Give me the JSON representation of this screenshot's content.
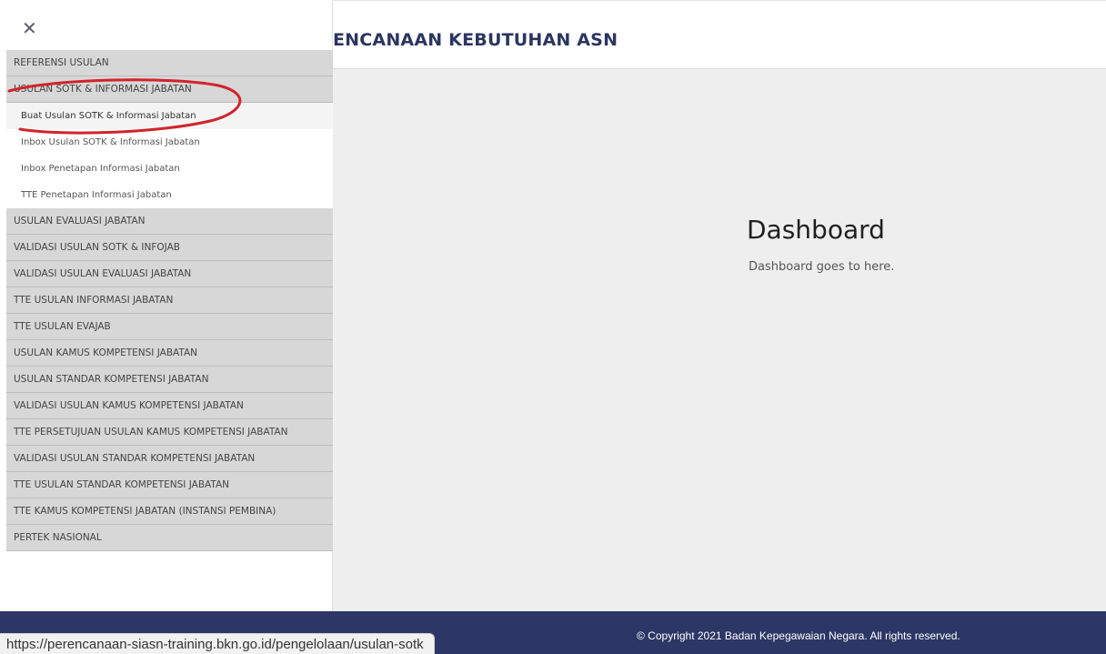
{
  "top_highlight_color": "#fff200",
  "header": {
    "title": "ENCANAAN KEBUTUHAN ASN"
  },
  "dashboard": {
    "title": "Dashboard",
    "subtitle": "Dashboard goes to here."
  },
  "sidebar": {
    "close_icon": "close-icon",
    "close_glyph": "✕",
    "items": [
      {
        "label": "REFERENSI USULAN",
        "type": "main"
      },
      {
        "label": "USULAN SOTK & INFORMASI JABATAN",
        "type": "main",
        "expanded": true
      },
      {
        "label": "Buat Usulan SOTK & Informasi Jabatan",
        "type": "sub",
        "active": true
      },
      {
        "label": "Inbox Usulan SOTK & Informasi Jabatan",
        "type": "sub"
      },
      {
        "label": "Inbox Penetapan Informasi Jabatan",
        "type": "sub"
      },
      {
        "label": "TTE Penetapan Informasi Jabatan",
        "type": "sub"
      },
      {
        "label": "USULAN EVALUASI JABATAN",
        "type": "main"
      },
      {
        "label": "VALIDASI USULAN SOTK & INFOJAB",
        "type": "main"
      },
      {
        "label": "VALIDASI USULAN EVALUASI JABATAN",
        "type": "main"
      },
      {
        "label": "TTE USULAN INFORMASI JABATAN",
        "type": "main"
      },
      {
        "label": "TTE USULAN EVAJAB",
        "type": "main"
      },
      {
        "label": "USULAN KAMUS KOMPETENSI JABATAN",
        "type": "main"
      },
      {
        "label": "USULAN STANDAR KOMPETENSI JABATAN",
        "type": "main"
      },
      {
        "label": "VALIDASI USULAN KAMUS KOMPETENSI JABATAN",
        "type": "main"
      },
      {
        "label": "TTE PERSETUJUAN USULAN KAMUS KOMPETENSI JABATAN",
        "type": "main"
      },
      {
        "label": "VALIDASI USULAN STANDAR KOMPETENSI JABATAN",
        "type": "main"
      },
      {
        "label": "TTE USULAN STANDAR KOMPETENSI JABATAN",
        "type": "main"
      },
      {
        "label": "TTE KAMUS KOMPETENSI JABATAN (INSTANSI PEMBINA)",
        "type": "main"
      },
      {
        "label": "PERTEK NASIONAL",
        "type": "main"
      }
    ]
  },
  "annotation": {
    "color": "#d0242b"
  },
  "footer": {
    "copyright": "© Copyright 2021 Badan Kepegawaian Negara. All rights reserved.",
    "background": "#2c3766"
  },
  "status_bar": {
    "url": "https://perencanaan-siasn-training.bkn.go.id/pengelolaan/usulan-sotk"
  }
}
